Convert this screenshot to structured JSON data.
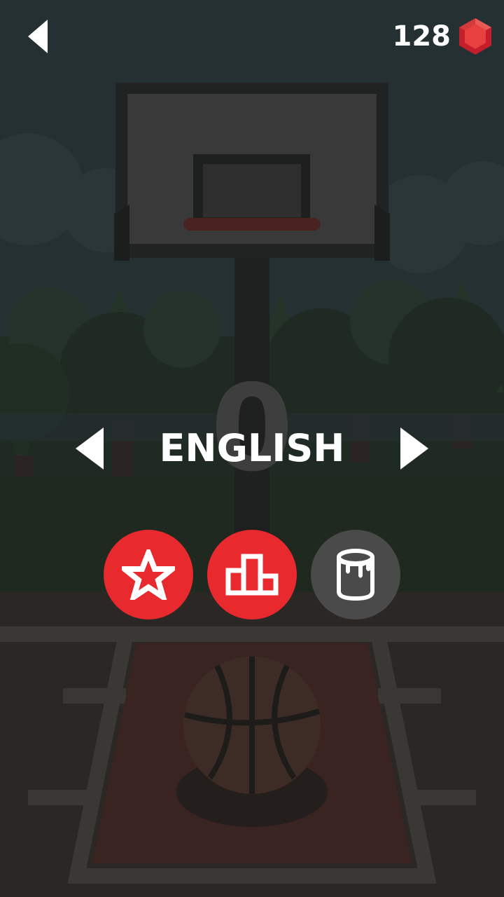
{
  "header": {
    "back_icon": "back-arrow-icon",
    "gem_count": "128",
    "gem_icon": "ruby-gem-icon"
  },
  "score": "0",
  "language_selector": {
    "label": "ENGLISH",
    "prev_icon": "chevron-left-icon",
    "next_icon": "chevron-right-icon"
  },
  "buttons": [
    {
      "icon": "star-icon",
      "color": "#e8292e"
    },
    {
      "icon": "podium-icon",
      "color": "#e8292e"
    },
    {
      "icon": "paint-bucket-icon",
      "color": "#4a4a4a"
    }
  ],
  "colors": {
    "accent": "#e8292e",
    "text": "#ffffff",
    "overlay": "#242424"
  }
}
